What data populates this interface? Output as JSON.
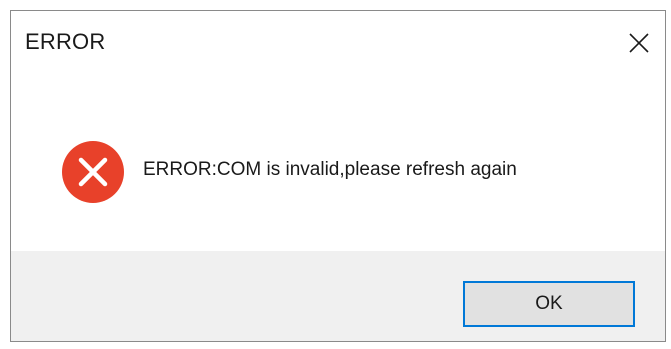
{
  "dialog": {
    "title": "ERROR",
    "message": "ERROR:COM is invalid,please refresh again",
    "ok_label": "OK",
    "icon": "error-icon",
    "close_icon": "close-icon"
  },
  "colors": {
    "error_red": "#e8412a",
    "focus_blue": "#0078d7",
    "footer_bg": "#f0f0f0",
    "button_bg": "#e1e1e1"
  }
}
